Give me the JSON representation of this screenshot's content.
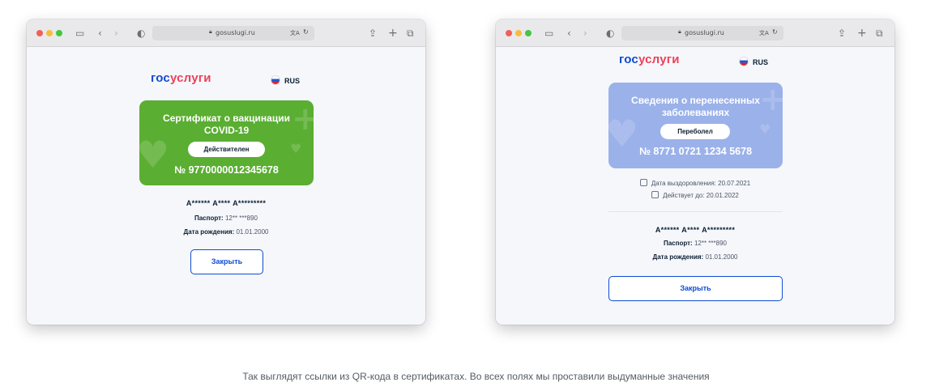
{
  "browser": {
    "url": "gosuslugi.ru",
    "lock_icon": "lock-icon",
    "translate_icon": "translate-icon",
    "reload_icon": "reload-icon"
  },
  "logo": {
    "part1": "гос",
    "part2": "услуги"
  },
  "lang": "RUS",
  "left": {
    "card_title_line1": "Сертификат о вакцинации",
    "card_title_line2": "COVID-19",
    "status": "Действителен",
    "number": "№ 9770000012345678",
    "name": "А****** А**** А*********",
    "passport_label": "Паспорт:",
    "passport_value": "12** ***890",
    "birth_label": "Дата рождения:",
    "birth_value": "01.01.2000",
    "close": "Закрыть",
    "card_color": "#5aae32"
  },
  "right": {
    "card_title_line1": "Сведения о перенесенных",
    "card_title_line2": "заболеваниях",
    "status": "Переболел",
    "number": "№ 8771 0721 1234 5678",
    "recovery_label": "Дата выздоровления:",
    "recovery_value": "20.07.2021",
    "valid_label": "Действует до:",
    "valid_value": "20.01.2022",
    "name": "А****** А**** А*********",
    "passport_label": "Паспорт:",
    "passport_value": "12** ***890",
    "birth_label": "Дата рождения:",
    "birth_value": "01.01.2000",
    "close": "Закрыть",
    "card_color": "#9bb1ea"
  },
  "caption": "Так выглядят ссылки из QR-кода в сертификатах. Во всех полях мы проставили выдуманные значения",
  "colors": {
    "brand_blue": "#0d4cd3",
    "brand_red": "#ee3f58"
  }
}
